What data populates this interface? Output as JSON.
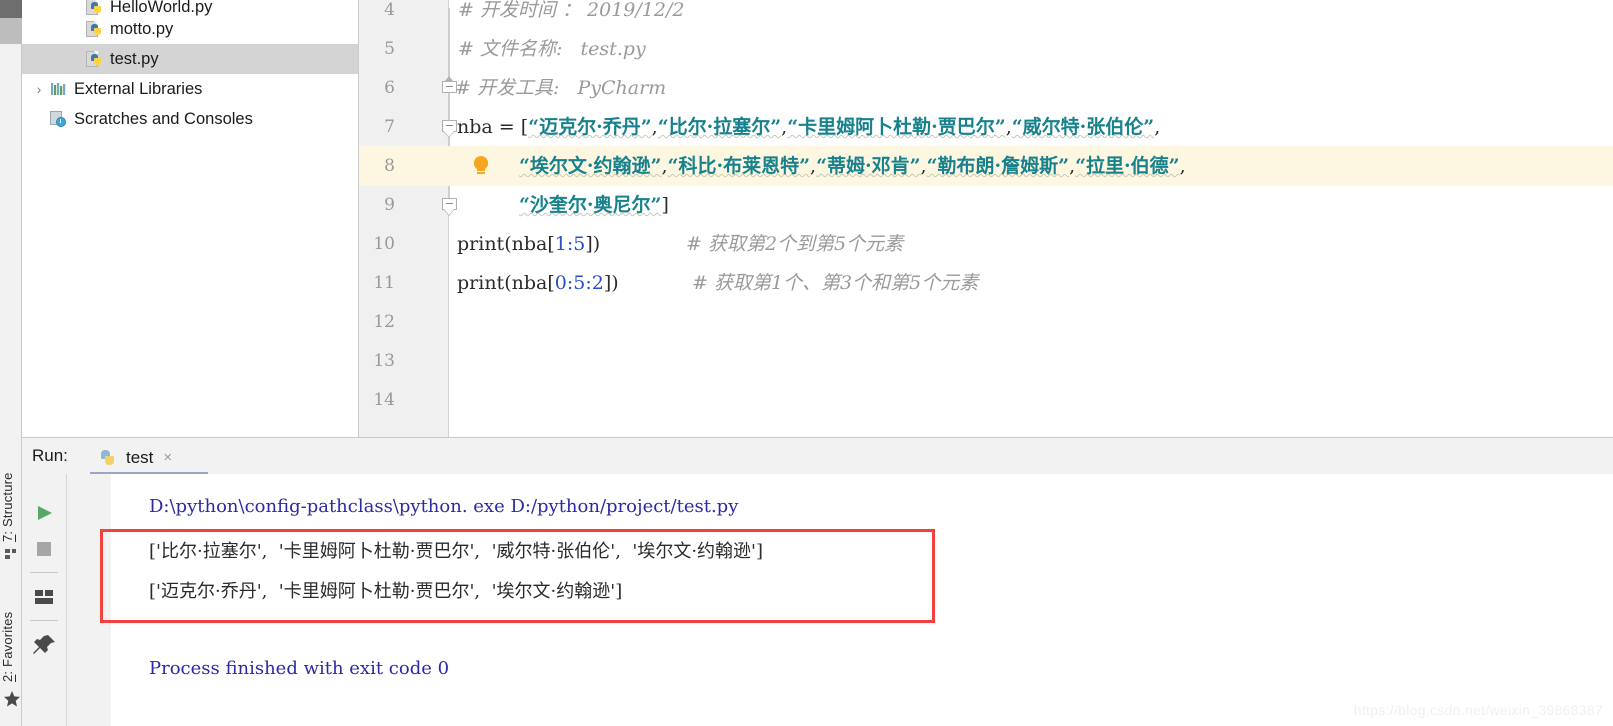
{
  "tool_strips": {
    "left": [
      {
        "name": "structure",
        "label_prefix": "7",
        "label": ": Structure",
        "icon": "structure-icon"
      },
      {
        "name": "favorites",
        "label_prefix": "2",
        "label": ": Favorites",
        "icon": "star-icon"
      }
    ]
  },
  "project_tree": {
    "items": [
      {
        "label": "HelloWorld.py",
        "icon": "python-file-icon",
        "indent": 2,
        "selected": false,
        "arrow": ""
      },
      {
        "label": "motto.py",
        "icon": "python-file-icon",
        "indent": 2,
        "selected": false,
        "arrow": ""
      },
      {
        "label": "test.py",
        "icon": "python-file-icon",
        "indent": 2,
        "selected": true,
        "arrow": ""
      },
      {
        "label": "External Libraries",
        "icon": "libraries-icon",
        "indent": 1,
        "selected": false,
        "arrow": "›"
      },
      {
        "label": "Scratches and Consoles",
        "icon": "scratches-icon",
        "indent": 1,
        "selected": false,
        "arrow": ""
      }
    ]
  },
  "editor": {
    "lines": [
      {
        "number": "4",
        "highlight": false
      },
      {
        "number": "5",
        "highlight": false
      },
      {
        "number": "6",
        "highlight": false
      },
      {
        "number": "7",
        "highlight": false
      },
      {
        "number": "8",
        "highlight": true
      },
      {
        "number": "9",
        "highlight": false
      },
      {
        "number": "10",
        "highlight": false
      },
      {
        "number": "11",
        "highlight": false
      },
      {
        "number": "12",
        "highlight": false
      },
      {
        "number": "13",
        "highlight": false
      },
      {
        "number": "14",
        "highlight": false
      }
    ],
    "code": {
      "l4_comment": "# 开发时间 ： 2019/12/2",
      "l5_comment": "# 文件名称:   test.py",
      "l6_comment": "# 开发工具:   PyCharm",
      "l7_var": "nba",
      "l7_eq": " = ",
      "l7_open": "[",
      "l7_s1": "“迈克尔·乔丹”",
      "l7_c1": ",",
      "l7_s2": "“比尔·拉塞尔”",
      "l7_c2": ",",
      "l7_s3": "“卡里姆阿卜杜勒·贾巴尔”",
      "l7_c3": ",",
      "l7_s4": "“威尔特·张伯伦”",
      "l7_c4": ",",
      "l8_s1": "“埃尔文·约翰逊”",
      "l8_c1": ",",
      "l8_s2": "“科比·布莱恩特”",
      "l8_c2": ",",
      "l8_s3": "“蒂姆·邓肯”",
      "l8_c3": ",",
      "l8_s4": "“勒布朗·詹姆斯”",
      "l8_c4": ",",
      "l8_s5": "“拉里·伯德”",
      "l8_c5": ",",
      "l9_s1": "“沙奎尔·奥尼尔”",
      "l9_close": "]",
      "l10_print": "print",
      "l10_open": "(nba",
      "l10_br1": "[",
      "l10_n1": "1",
      "l10_colon": ":",
      "l10_n2": "5",
      "l10_br2": "]",
      "l10_close": ")",
      "l10_comment": "# 获取第2个到第5个元素",
      "l11_print": "print",
      "l11_open": "(nba",
      "l11_br1": "[",
      "l11_n1": "0",
      "l11_colon1": ":",
      "l11_n2": "5",
      "l11_colon2": ":",
      "l11_n3": "2",
      "l11_br2": "]",
      "l11_close": ")",
      "l11_comment": "# 获取第1个、第3个和第5个元素"
    }
  },
  "run_panel": {
    "label": "Run:",
    "tab_name": "test",
    "tab_close": "×",
    "toolbar_left": [
      {
        "name": "run-button",
        "icon": "play-icon"
      },
      {
        "name": "stop-button",
        "icon": "stop-icon"
      },
      {
        "name": "restore-layout-button",
        "icon": "layout-icon"
      },
      {
        "name": "pin-tab-button",
        "icon": "pin-icon"
      }
    ],
    "toolbar_right": [
      {
        "name": "prev-occurrence-button",
        "icon": "arrow-up-icon"
      },
      {
        "name": "next-occurrence-button",
        "icon": "arrow-down-icon"
      },
      {
        "name": "soft-wrap-button",
        "icon": "soft-wrap-icon"
      },
      {
        "name": "scroll-to-end-button",
        "icon": "scroll-end-icon",
        "selected": true
      },
      {
        "name": "print-button",
        "icon": "printer-icon"
      }
    ],
    "console": {
      "command": "D:\\python\\config-pathclass\\python. exe D:/python/project/test.py",
      "output_1": "['比尔·拉塞尔',  '卡里姆阿卜杜勒·贾巴尔',  '威尔特·张伯伦',  '埃尔文·约翰逊']",
      "output_2": "['迈克尔·乔丹',  '卡里姆阿卜杜勒·贾巴尔',  '埃尔文·约翰逊']",
      "finished": "Process finished with exit code 0"
    }
  },
  "annotation": {
    "color": "#f4413c"
  },
  "watermark": "https://blog.csdn.net/weixin_39868387"
}
